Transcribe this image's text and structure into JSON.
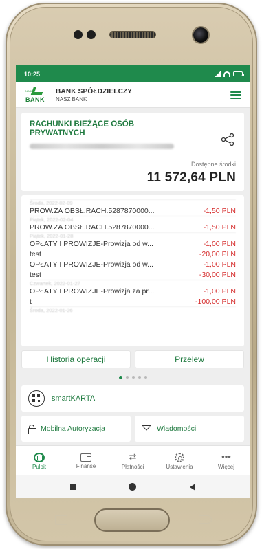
{
  "status_bar": {
    "time": "10:25"
  },
  "header": {
    "logo_text": "BANK",
    "logo_small": "NASZ",
    "bank_title": "BANK SPÓŁDZIELCZY",
    "bank_subtitle": "NASZ BANK"
  },
  "account": {
    "title": "RACHUNKI BIEŻĄCE OSÓB PRYWATNYCH",
    "available_label": "Dostępne środki",
    "available_amount": "11 572,64 PLN"
  },
  "history": {
    "rows": [
      {
        "date": "Środa, 2022-02-09"
      },
      {
        "desc": "PROW.ZA OBSŁ.RACH.5287870000...",
        "amount": "-1,50 PLN"
      },
      {
        "date": "Piątek, 2022-02-04"
      },
      {
        "desc": "PROW.ZA OBSŁ.RACH.5287870000...",
        "amount": "-1,50 PLN"
      },
      {
        "date": "Piątek, 2022-01-28"
      },
      {
        "desc": "OPŁATY I PROWIZJE-Prowizja od w...",
        "amount": "-1,00 PLN"
      },
      {
        "desc": "test",
        "amount": "-20,00 PLN"
      },
      {
        "desc": "OPŁATY I PROWIZJE-Prowizja od w...",
        "amount": "-1,00 PLN"
      },
      {
        "desc": "test",
        "amount": "-30,00 PLN"
      },
      {
        "date": "Czwartek, 2022-01-27"
      },
      {
        "desc": "OPŁATY I PROWIZJE-Prowizja za pr...",
        "amount": "-1,00 PLN"
      },
      {
        "desc": "t",
        "amount": "-100,00 PLN"
      },
      {
        "date": "Środa, 2022-01-26"
      }
    ],
    "history_button": "Historia operacji",
    "transfer_button": "Przelew"
  },
  "carousel": {
    "active_index": 0,
    "count": 5
  },
  "smartkarta": {
    "label": "smartKARTA"
  },
  "actions": {
    "mobile_auth": "Mobilna Autoryzacja",
    "messages": "Wiadomości"
  },
  "bottom_nav": {
    "items": [
      {
        "label": "Pulpit",
        "icon": "home-icon",
        "active": true
      },
      {
        "label": "Finanse",
        "icon": "wallet-icon",
        "active": false
      },
      {
        "label": "Płatności",
        "icon": "transfer-arrows-icon",
        "active": false
      },
      {
        "label": "Ustawienia",
        "icon": "gear-icon",
        "active": false
      },
      {
        "label": "Więcej",
        "icon": "more-icon",
        "active": false
      }
    ]
  },
  "colors": {
    "brand_green": "#1f8a4c",
    "text_green": "#1f7a3f",
    "negative_red": "#d52a2a"
  }
}
